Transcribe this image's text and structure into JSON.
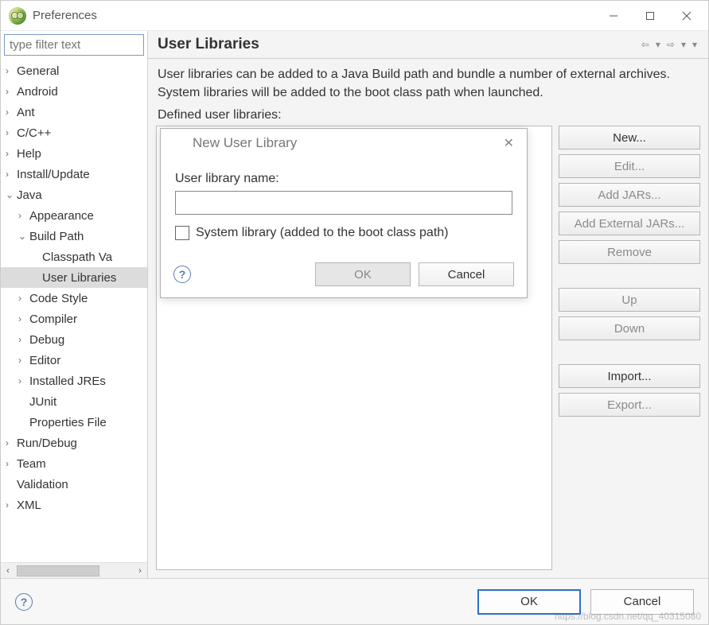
{
  "window": {
    "title": "Preferences"
  },
  "filter": {
    "placeholder": "type filter text"
  },
  "tree": [
    {
      "label": "General",
      "depth": 0,
      "arrow": "›",
      "sel": false
    },
    {
      "label": "Android",
      "depth": 0,
      "arrow": "›",
      "sel": false
    },
    {
      "label": "Ant",
      "depth": 0,
      "arrow": "›",
      "sel": false
    },
    {
      "label": "C/C++",
      "depth": 0,
      "arrow": "›",
      "sel": false
    },
    {
      "label": "Help",
      "depth": 0,
      "arrow": "›",
      "sel": false
    },
    {
      "label": "Install/Update",
      "depth": 0,
      "arrow": "›",
      "sel": false
    },
    {
      "label": "Java",
      "depth": 0,
      "arrow": "⌄",
      "sel": false
    },
    {
      "label": "Appearance",
      "depth": 1,
      "arrow": "›",
      "sel": false
    },
    {
      "label": "Build Path",
      "depth": 1,
      "arrow": "⌄",
      "sel": false
    },
    {
      "label": "Classpath Va",
      "depth": 2,
      "arrow": "",
      "sel": false
    },
    {
      "label": "User Libraries",
      "depth": 2,
      "arrow": "",
      "sel": true
    },
    {
      "label": "Code Style",
      "depth": 1,
      "arrow": "›",
      "sel": false
    },
    {
      "label": "Compiler",
      "depth": 1,
      "arrow": "›",
      "sel": false
    },
    {
      "label": "Debug",
      "depth": 1,
      "arrow": "›",
      "sel": false
    },
    {
      "label": "Editor",
      "depth": 1,
      "arrow": "›",
      "sel": false
    },
    {
      "label": "Installed JREs",
      "depth": 1,
      "arrow": "›",
      "sel": false
    },
    {
      "label": "JUnit",
      "depth": 1,
      "arrow": "",
      "sel": false
    },
    {
      "label": "Properties File",
      "depth": 1,
      "arrow": "",
      "sel": false
    },
    {
      "label": "Run/Debug",
      "depth": 0,
      "arrow": "›",
      "sel": false
    },
    {
      "label": "Team",
      "depth": 0,
      "arrow": "›",
      "sel": false
    },
    {
      "label": "Validation",
      "depth": 0,
      "arrow": "",
      "sel": false
    },
    {
      "label": "XML",
      "depth": 0,
      "arrow": "›",
      "sel": false
    }
  ],
  "page": {
    "title": "User Libraries",
    "description": "User libraries can be added to a Java Build path and bundle a number of external archives. System libraries will be added to the boot class path when launched.",
    "defined_label": "Defined user libraries:"
  },
  "side_buttons": {
    "new": "New...",
    "edit": "Edit...",
    "add_jars": "Add JARs...",
    "add_ext": "Add External JARs...",
    "remove": "Remove",
    "up": "Up",
    "down": "Down",
    "import": "Import...",
    "export": "Export..."
  },
  "dialog": {
    "title": "New User Library",
    "name_label": "User library name:",
    "name_value": "",
    "system_label": "System library (added to the boot class path)",
    "ok": "OK",
    "cancel": "Cancel"
  },
  "footer": {
    "ok": "OK",
    "cancel": "Cancel"
  },
  "watermark": "https://blog.csdn.net/qq_40315080"
}
